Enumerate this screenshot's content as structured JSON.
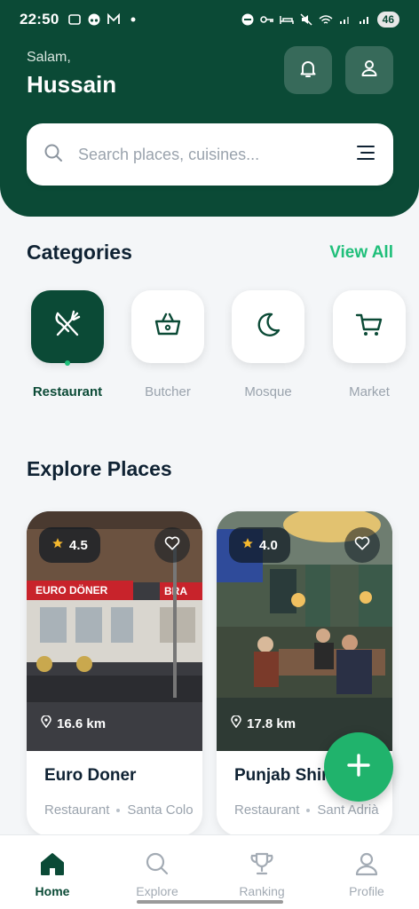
{
  "status_bar": {
    "time": "22:50",
    "battery": "46"
  },
  "header": {
    "greeting": "Salam,",
    "user_name": "Hussain"
  },
  "search": {
    "placeholder": "Search places, cuisines..."
  },
  "categories": {
    "title": "Categories",
    "view_all": "View All",
    "items": [
      {
        "label": "Restaurant",
        "icon": "fork-knife-icon",
        "active": true
      },
      {
        "label": "Butcher",
        "icon": "basket-icon",
        "active": false
      },
      {
        "label": "Mosque",
        "icon": "moon-icon",
        "active": false
      },
      {
        "label": "Market",
        "icon": "cart-icon",
        "active": false
      }
    ]
  },
  "explore": {
    "title": "Explore Places",
    "places": [
      {
        "name": "Euro Doner",
        "rating": "4.5",
        "distance": "16.6 km",
        "category": "Restaurant",
        "location": "Santa Colo",
        "photo_sign": "EURO DÖNER",
        "photo_sign2": "BRA"
      },
      {
        "name": "Punjab Shir",
        "rating": "4.0",
        "distance": "17.8 km",
        "category": "Restaurant",
        "location": "Sant Adrià"
      }
    ]
  },
  "bottom_nav": {
    "items": [
      {
        "label": "Home",
        "icon": "home-icon",
        "active": true
      },
      {
        "label": "Explore",
        "icon": "search-icon",
        "active": false
      },
      {
        "label": "Ranking",
        "icon": "trophy-icon",
        "active": false
      },
      {
        "label": "Profile",
        "icon": "profile-icon",
        "active": false
      }
    ]
  },
  "colors": {
    "primary": "#0b4a36",
    "accent": "#1fbf7a",
    "fab": "#20b36c",
    "muted": "#9aa3ad"
  }
}
